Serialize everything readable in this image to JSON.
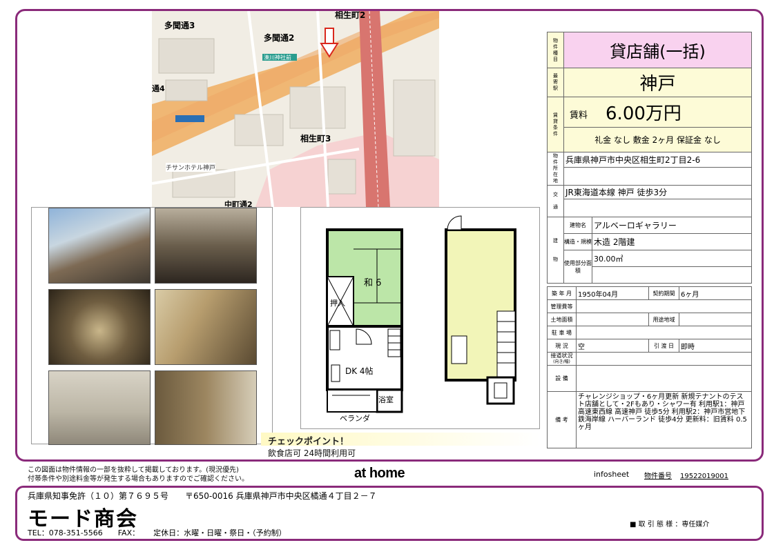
{
  "map": {
    "labels": {
      "tamon3": "多聞通3",
      "tamon2": "多聞通2",
      "aioi2": "相生町2",
      "aioi3": "相生町3",
      "block4": "通4",
      "naka2": "中町通2",
      "hotel": "チサンホテル神戸",
      "minatogawa": "湊川神社前",
      "kobe": "神戸"
    },
    "colors": {
      "road": "#f0b774",
      "rail": "#d8756f",
      "area": "#f6d2d2",
      "arrow": "#d9271c"
    }
  },
  "photos": {
    "count": 6
  },
  "floorplan": {
    "room1": "和 6",
    "closet": "押入",
    "dk": "DK 4帖",
    "bath": "浴室",
    "veranda": "ベランダ"
  },
  "checkpoint": {
    "title": "チェックポイント！",
    "text": "飲食店可 24時間利用可"
  },
  "info": {
    "type_label": [
      "物",
      "件",
      "種",
      "目"
    ],
    "type_value": "貸店舗(一括)",
    "station_label": [
      "最",
      "寄",
      "駅"
    ],
    "station_value": "神戸",
    "rent_label": [
      "賃",
      "貸",
      "条",
      "件"
    ],
    "rent_caption": "賃料",
    "rent_value": "6.00万円",
    "conditions": "礼金 なし 敷金 2ヶ月 保証金 なし",
    "address_label": [
      "物",
      "件",
      "所",
      "在",
      "地"
    ],
    "address": "兵庫県神戸市中央区相生町2丁目2-6",
    "transport_label": [
      "交",
      "通"
    ],
    "transport": "JR東海道本線 神戸 徒歩3分",
    "building_label": [
      "建",
      "物"
    ],
    "building_name_label": "建物名",
    "building_name": "アルベーロギャラリー",
    "structure_label": "構造・規模",
    "structure": "木造 2階建",
    "area_label": "使用部分面積",
    "area": "30.00㎡",
    "built_label": "築 年 月",
    "built": "1950年04月",
    "contract_label": "契約期間",
    "contract": "6ヶ月",
    "mgmt_label": "管理費等",
    "land_label": "土地面積",
    "use_label": "用途地域",
    "parking_label": "駐 車 場",
    "status_label": "現 況",
    "status": "空",
    "handover_label": "引 渡 日",
    "handover": "即時",
    "road_label": "接道状況",
    "road_sub": "(向き/幅)",
    "equipment_label": "設 備",
    "remarks_label": "備 考",
    "remarks": "チャレンジショップ・6ヶ月更新 新規テナントのテスト店舗として・2Fもあり・シャワー有 利用駅1：神戸高速東西線 高速神戸 徒歩5分 利用駅2：神戸市営地下鉄海岸線 ハーバーランド 徒歩4分 更新料：旧賃料 0.5ヶ月"
  },
  "footer": {
    "note1": "この図面は物件情報の一部を抜粋して掲載しております。(現況優先)",
    "note2": "付帯条件や別途料金等が発生する場合もありますのでご確認ください。",
    "brand": "at home",
    "infosheet": "infosheet",
    "bukken_label": "物件番号",
    "bukken_no": "19522019001",
    "license": "兵庫県知事免許（１０）第７６９５号　　〒650-0016 兵庫県神戸市中央区橘通４丁目２－７",
    "company": "モード商会",
    "tel": "TEL：078-351-5566　　FAX：　　 定休日：水曜・日曜・祭日・（予約制）",
    "torihiki": "■ 取 引 態 様 ：専任媒介"
  }
}
